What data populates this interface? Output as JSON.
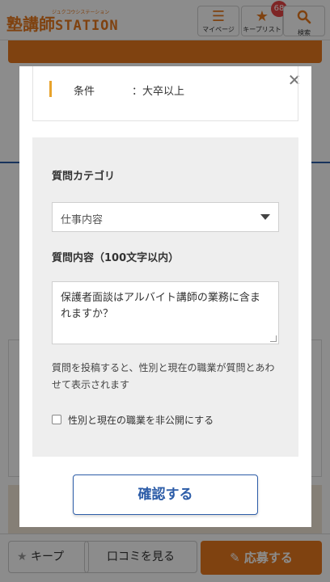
{
  "header": {
    "logo_main": "塾講師",
    "logo_station": "STATION",
    "logo_sub": "ジュクコウシステーション",
    "mypage_label": "マイページ",
    "keeplist_label": "キープリスト",
    "keeplist_count": "68",
    "search_label": "検索"
  },
  "background": {
    "bottom_bar": {
      "keep_label": "キープ",
      "review_label": "口コミを見る",
      "apply_label": "応募する"
    }
  },
  "modal": {
    "condition": {
      "label": "条件",
      "value": "：大卒以上"
    },
    "form": {
      "category_label": "質問カテゴリ",
      "category_selected": "仕事内容",
      "question_label": "質問内容（100文字以内）",
      "question_value": "保護者面談はアルバイト講師の業務に含まれますか？",
      "notice": "質問を投稿すると、性別と現在の職業が質問とあわせて表示されます",
      "private_checkbox_label": "性別と現在の職業を非公開にする",
      "private_checked": false
    },
    "confirm_label": "確認する"
  },
  "colors": {
    "brand_orange": "#e8791e",
    "accent_blue": "#2d5da8",
    "badge_red": "#e64444",
    "condition_mark": "#e8a32c"
  }
}
